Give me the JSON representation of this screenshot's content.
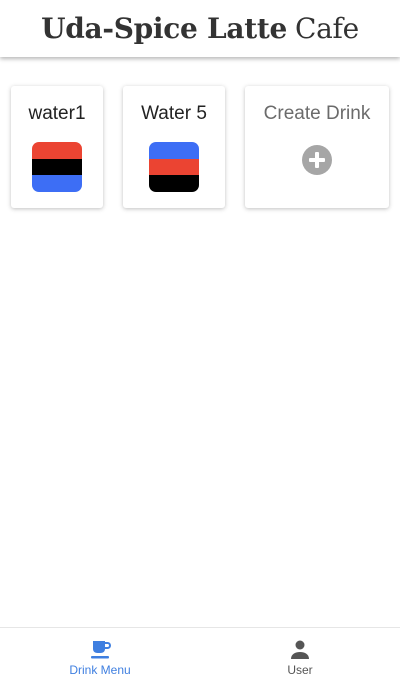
{
  "header": {
    "title_bold": "Uda-Spice Latte",
    "title_light": "Cafe"
  },
  "drinks": [
    {
      "name": "water1",
      "layers": [
        "#eb4432",
        "#000000",
        "#3d6ef5"
      ]
    },
    {
      "name": "Water 5",
      "layers": [
        "#3d6ef5",
        "#eb4432",
        "#000000"
      ]
    }
  ],
  "create_card": {
    "label": "Create Drink",
    "icon": "add-circle-icon"
  },
  "bottom_nav": {
    "tabs": [
      {
        "label": "Drink Menu",
        "icon": "coffee-cup-icon",
        "active": true
      },
      {
        "label": "User",
        "icon": "person-icon",
        "active": false
      }
    ]
  },
  "colors": {
    "active_tab": "#3f7fe0",
    "inactive_tab": "#555555",
    "add_icon": "#a6a6a6"
  }
}
